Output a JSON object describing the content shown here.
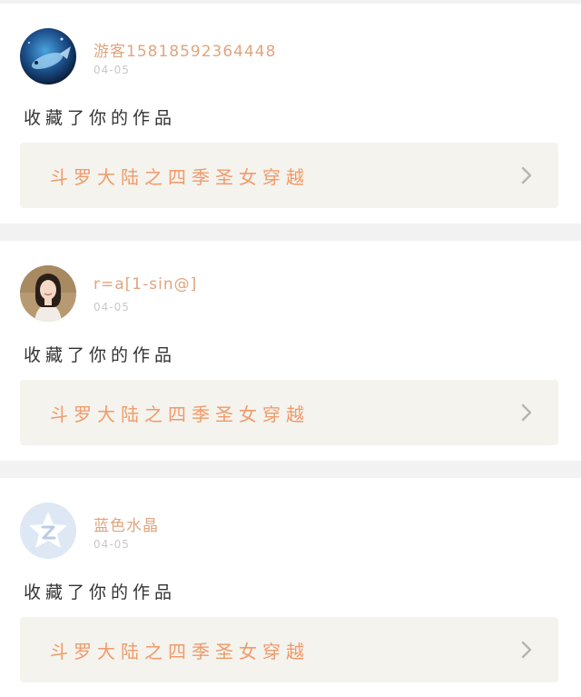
{
  "items": [
    {
      "avatar": "fish-avatar",
      "username": "游客15818592364448",
      "date": "04-05",
      "action": "收藏了你的作品",
      "work_title": "斗罗大陆之四季圣女穿越",
      "link_icon": "chevron-right-icon"
    },
    {
      "avatar": "woman-portrait-avatar",
      "username": "r=a[1-sin@]",
      "date": "04-05",
      "action": "收藏了你的作品",
      "work_title": "斗罗大陆之四季圣女穿越",
      "link_icon": "chevron-right-icon"
    },
    {
      "avatar": "default-z-star-avatar",
      "username": "蓝色水晶",
      "date": "04-05",
      "action": "收藏了你的作品",
      "work_title": "斗罗大陆之四季圣女穿越",
      "link_icon": "chevron-right-icon"
    }
  ],
  "colors": {
    "username": "#e0a47e",
    "date": "#c9c9c9",
    "action": "#333333",
    "work_title": "#f09a6a",
    "work_background": "#f4f3ed",
    "divider": "#f2f2f2"
  }
}
